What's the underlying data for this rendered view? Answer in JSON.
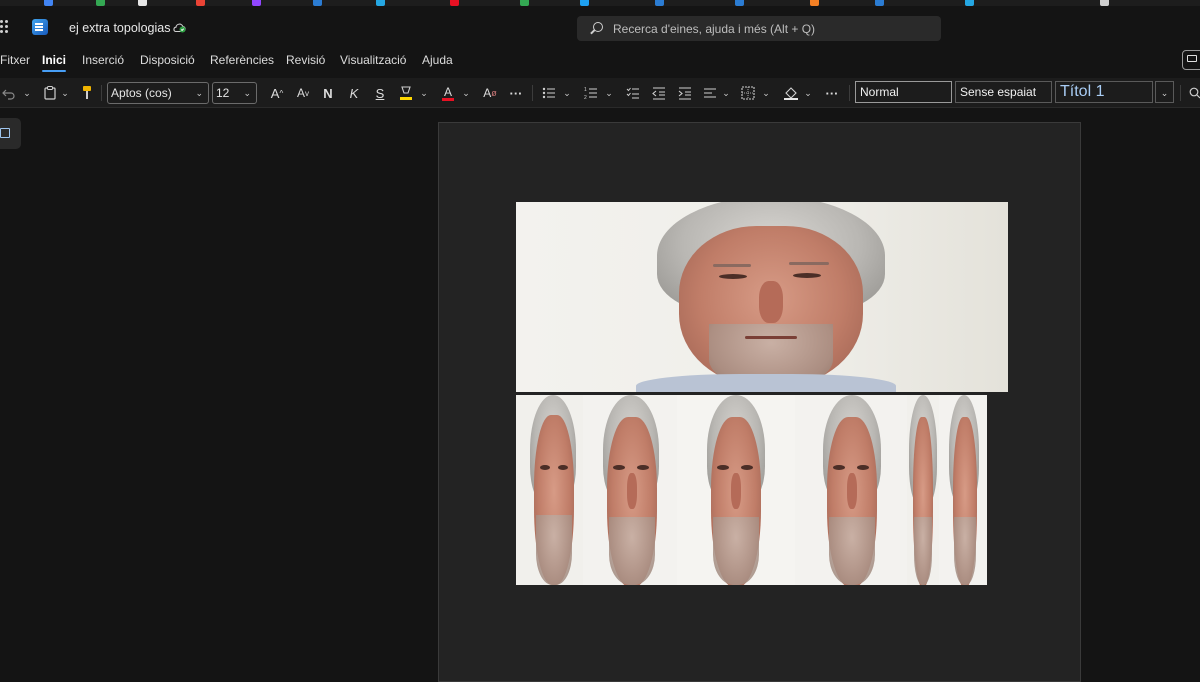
{
  "titlebar": {
    "doc_title": "ej extra topologias"
  },
  "search": {
    "placeholder": "Recerca d'eines, ajuda i més (Alt + Q)"
  },
  "tabs": [
    {
      "label": "Fitxer"
    },
    {
      "label": "Inici"
    },
    {
      "label": "Inserció"
    },
    {
      "label": "Disposició"
    },
    {
      "label": "Referències"
    },
    {
      "label": "Revisió"
    },
    {
      "label": "Visualització"
    },
    {
      "label": "Ajuda"
    }
  ],
  "active_tab": "Inici",
  "ribbon": {
    "font_name": "Aptos (cos)",
    "font_size": "12",
    "bold_label": "N",
    "italic_label": "K",
    "underline_label": "S",
    "more_label": "···",
    "styles": [
      "Normal",
      "Sense espaiat",
      "Títol 1"
    ]
  },
  "colors": {
    "accent": "#479ef5",
    "font_color_bar": "#e81123",
    "highlight_bar": "#ffd800",
    "background": "#141414",
    "page": "#232323"
  },
  "document": {
    "images": [
      {
        "description": "portrait photo",
        "type": "photo"
      },
      {
        "description": "repeated stretched portrait strip",
        "type": "photo"
      }
    ]
  }
}
